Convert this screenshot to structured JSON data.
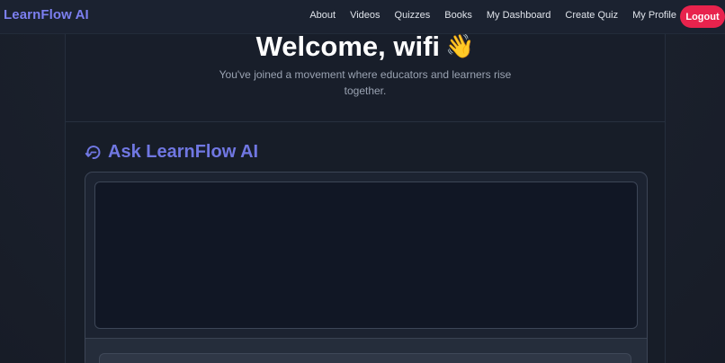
{
  "navbar": {
    "brand": "LearnFlow AI",
    "links": [
      "About",
      "Videos",
      "Quizzes",
      "Books",
      "My Dashboard",
      "Create Quiz",
      "My Profile"
    ],
    "logout_label": "Logout"
  },
  "welcome": {
    "title": "Welcome, wifi",
    "emoji": "👋",
    "subtitle": "You've joined a movement where educators and learners rise together."
  },
  "ask": {
    "heading": "Ask LearnFlow AI",
    "icon": "chat-refresh-icon"
  },
  "colors": {
    "brand": "#7c7ff0",
    "accent": "#7077e2",
    "logout": "#e8234d",
    "background": "#1a202c"
  }
}
